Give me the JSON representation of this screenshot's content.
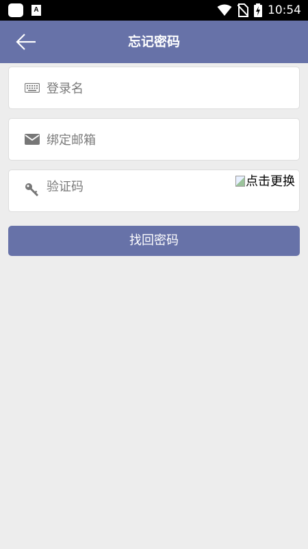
{
  "status_bar": {
    "time": "10:54",
    "notification_icon_letter": "A"
  },
  "app_bar": {
    "title": "忘记密码"
  },
  "form": {
    "username_placeholder": "登录名",
    "email_placeholder": "绑定邮箱",
    "captcha_placeholder": "验证码",
    "captcha_image_alt": "点击更换",
    "submit_label": "找回密码"
  },
  "colors": {
    "primary": "#6772a8",
    "background": "#ededed",
    "status_bar": "#000000"
  },
  "icons": {
    "back": "arrow-left-icon",
    "username": "keyboard-icon",
    "email": "envelope-icon",
    "captcha": "key-icon"
  }
}
